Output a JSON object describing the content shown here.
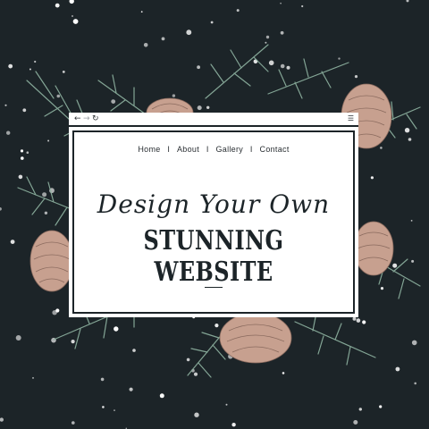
{
  "colors": {
    "background": "#1c2428",
    "page": "#ffffff",
    "ink": "#1c2428",
    "pine": "#8fb3a1",
    "cone": "#c7a08f"
  },
  "browser": {
    "icons": {
      "back": "back-arrow-icon",
      "forward": "forward-arrow-icon",
      "reload": "reload-icon",
      "menu": "hamburger-menu-icon"
    },
    "nav": [
      {
        "label": "Home"
      },
      {
        "label": "About"
      },
      {
        "label": "Gallery"
      },
      {
        "label": "Contact"
      }
    ],
    "separator": "I",
    "headline_script": "Design Your Own",
    "headline_main": "STUNNING WEBSITE"
  }
}
